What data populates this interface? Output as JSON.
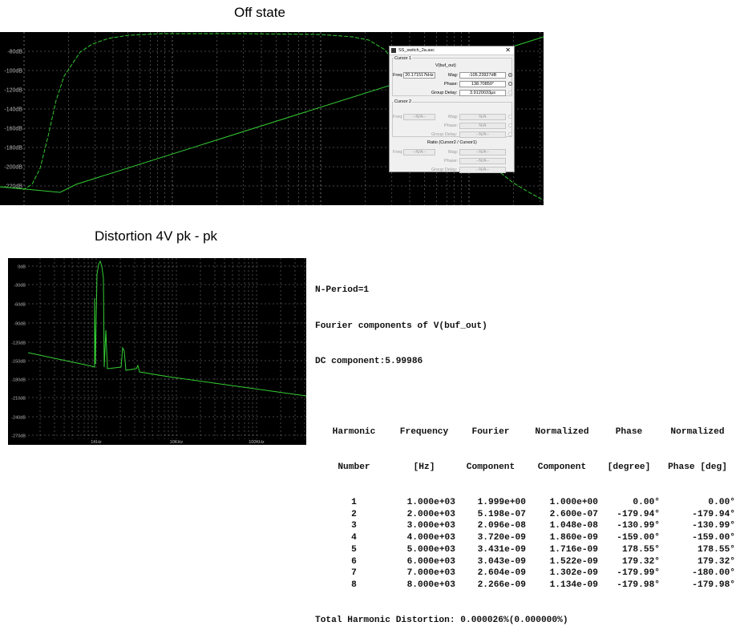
{
  "titles": {
    "off_state": "Off state",
    "distortion": "Distortion 4V pk - pk"
  },
  "colors": {
    "plot_bg": "#000000",
    "trace": "#33cc33",
    "grid": "#8a8a8a",
    "axis_label": "#bbbbbb"
  },
  "plot1": {
    "y_ticks": [
      "-80dB",
      "-100dB",
      "-120dB",
      "-140dB",
      "-160dB",
      "-180dB",
      "-200dB",
      "-220dB"
    ]
  },
  "cursor_dialog": {
    "title": "SS_switch_2a.asc",
    "cursor1": {
      "group": "Cursor 1",
      "trace": "V(buf_out)",
      "freq_label": "Freq:",
      "freq_value": "20.171517kHz",
      "mag_label": "Mag:",
      "mag_value": "-105.23927dB",
      "phase_label": "Phase:",
      "phase_value": "138.70850°",
      "gd_label": "Group Delay:",
      "gd_value": "3.9120033µs"
    },
    "cursor2": {
      "group": "Cursor 2",
      "freq_label": "Freq:",
      "freq_value": "--N/A--",
      "mag_label": "Mag:",
      "mag_value": "N/A",
      "phase_label": "Phase:",
      "phase_value": "N/A",
      "gd_label": "Group Delay:",
      "gd_value": "--N/A--"
    },
    "ratio": {
      "group": "Ratio (Cursor2 / Cursor1)",
      "freq_label": "Freq:",
      "freq_value": "--N/A--",
      "mag_label": "Mag:",
      "mag_value": "--N/A--",
      "phase_label": "Phase:",
      "phase_value": "--N/A--",
      "gd_label": "Group Delay:",
      "gd_value": "--N/A--"
    }
  },
  "plot2": {
    "y_ticks": [
      "0dB",
      "-30dB",
      "-60dB",
      "-90dB",
      "-120dB",
      "-150dB",
      "-180dB",
      "-210dB",
      "-240dB",
      "-270dB"
    ],
    "x_ticks": [
      "1KHz",
      "10KHz",
      "100KHz"
    ]
  },
  "fourier": {
    "nperiod": "N-Period=1",
    "header_line": "Fourier components of V(buf_out)",
    "dc": "DC component:5.99986",
    "col_headers_1": [
      "Harmonic",
      "Frequency",
      "Fourier",
      "Normalized",
      "Phase",
      "Normalized"
    ],
    "col_headers_2": [
      "Number",
      "[Hz]",
      "Component",
      "Component",
      "[degree]",
      "Phase [deg]"
    ],
    "rows": [
      [
        "1",
        "1.000e+03",
        "1.999e+00",
        "1.000e+00",
        "0.00°",
        "0.00°"
      ],
      [
        "2",
        "2.000e+03",
        "5.198e-07",
        "2.600e-07",
        "-179.94°",
        "-179.94°"
      ],
      [
        "3",
        "3.000e+03",
        "2.096e-08",
        "1.048e-08",
        "-130.99°",
        "-130.99°"
      ],
      [
        "4",
        "4.000e+03",
        "3.720e-09",
        "1.860e-09",
        "-159.00°",
        "-159.00°"
      ],
      [
        "5",
        "5.000e+03",
        "3.431e-09",
        "1.716e-09",
        "178.55°",
        "178.55°"
      ],
      [
        "6",
        "6.000e+03",
        "3.043e-09",
        "1.522e-09",
        "179.32°",
        "179.32°"
      ],
      [
        "7",
        "7.000e+03",
        "2.604e-09",
        "1.302e-09",
        "-179.99°",
        "-180.00°"
      ],
      [
        "8",
        "8.000e+03",
        "2.266e-09",
        "1.134e-09",
        "-179.98°",
        "-179.98°"
      ]
    ],
    "thd": "Total Harmonic Distortion: 0.000026%(0.000000%)"
  }
}
